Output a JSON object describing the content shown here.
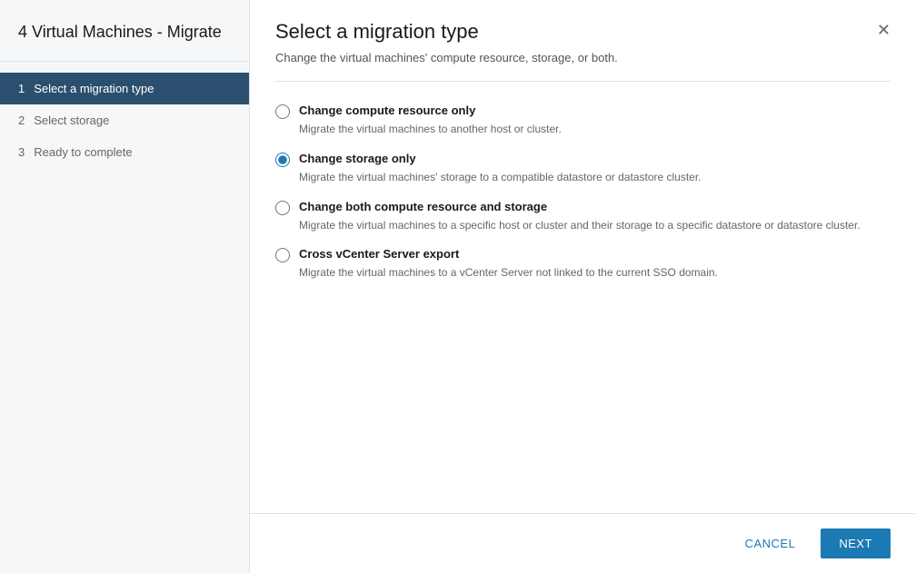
{
  "sidebar": {
    "title": "4 Virtual Machines - Migrate",
    "steps": [
      {
        "number": "1",
        "label": "Select a migration type",
        "active": true
      },
      {
        "number": "2",
        "label": "Select storage",
        "active": false
      },
      {
        "number": "3",
        "label": "Ready to complete",
        "active": false
      }
    ]
  },
  "main": {
    "title": "Select a migration type",
    "subtitle": "Change the virtual machines' compute resource, storage, or both.",
    "options": [
      {
        "id": "opt-compute",
        "label": "Change compute resource only",
        "description": "Migrate the virtual machines to another host or cluster.",
        "checked": false
      },
      {
        "id": "opt-storage",
        "label": "Change storage only",
        "description": "Migrate the virtual machines' storage to a compatible datastore or datastore cluster.",
        "checked": true
      },
      {
        "id": "opt-both",
        "label": "Change both compute resource and storage",
        "description": "Migrate the virtual machines to a specific host or cluster and their storage to a specific datastore or datastore cluster.",
        "checked": false
      },
      {
        "id": "opt-vcenter",
        "label": "Cross vCenter Server export",
        "description": "Migrate the virtual machines to a vCenter Server not linked to the current SSO domain.",
        "checked": false
      }
    ]
  },
  "footer": {
    "cancel_label": "CANCEL",
    "next_label": "NEXT"
  },
  "icons": {
    "close": "✕"
  }
}
